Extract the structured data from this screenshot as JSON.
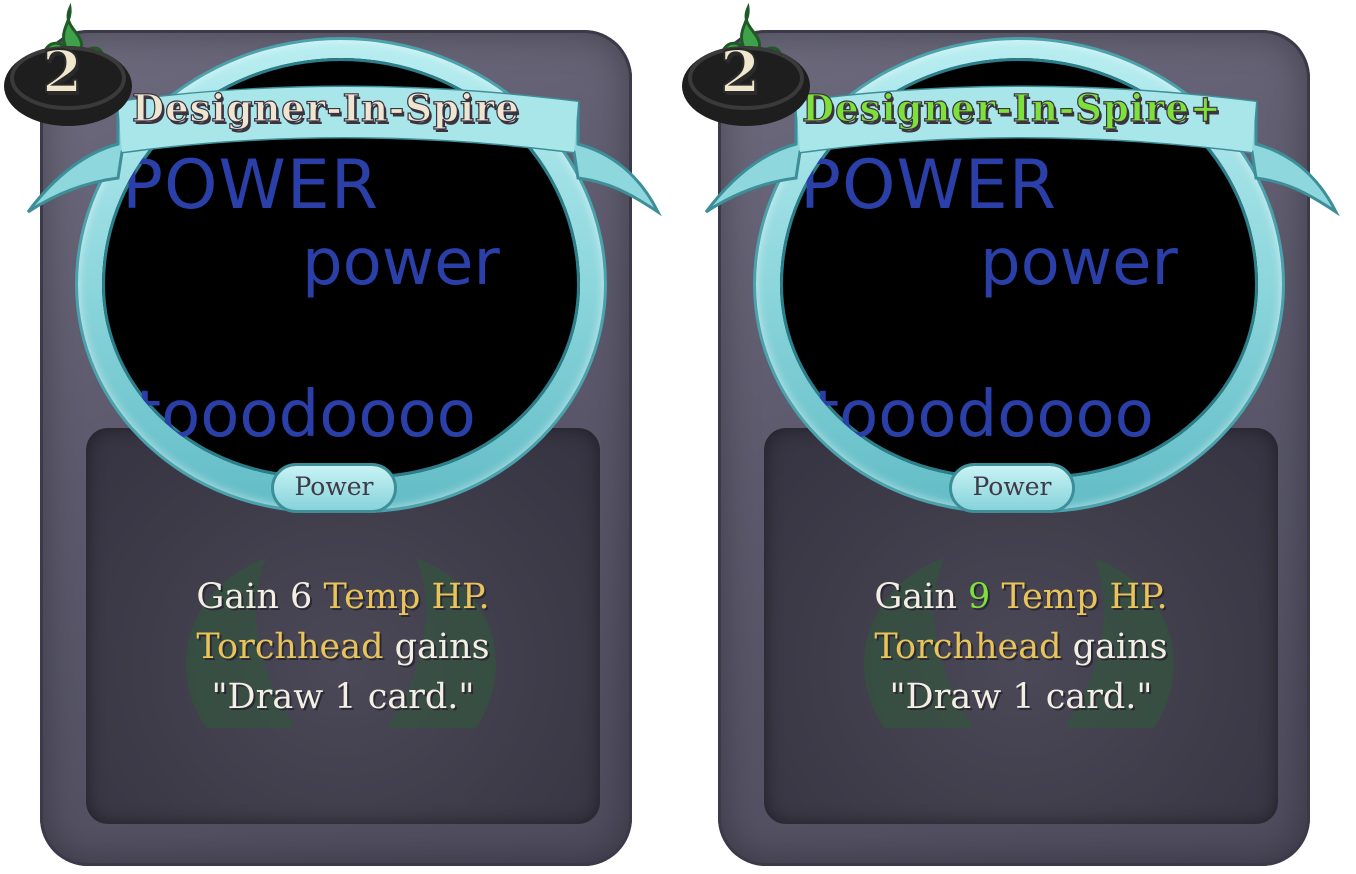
{
  "cards": [
    {
      "cost": "2",
      "title": "Designer-In-Spire",
      "title_color": "#efe6d2",
      "art_lines": [
        "POWER",
        "power",
        "tooodoooo"
      ],
      "type_label": "Power",
      "description": {
        "line1_pre": "Gain ",
        "line1_value": "6",
        "line1_keyword": "Temp HP",
        "line1_post": ".",
        "line2_keyword": "Torchhead",
        "line2_post": " gains",
        "line3": "\"Draw 1 card.\""
      }
    },
    {
      "cost": "2",
      "title": "Designer-In-Spire+",
      "title_color": "#7ee03a",
      "art_lines": [
        "POWER",
        "power",
        "tooodoooo"
      ],
      "type_label": "Power",
      "description": {
        "line1_pre": "Gain ",
        "line1_value": "9",
        "line1_keyword": "Temp HP",
        "line1_post": ".",
        "line2_keyword": "Torchhead",
        "line2_post": " gains",
        "line3": "\"Draw 1 card.\""
      }
    }
  ],
  "colors": {
    "keyword_gold": "#e9c45a",
    "upgrade_green": "#7ee03a",
    "art_text_blue": "#2a3fa8",
    "frame_teal": "#8ed7dd"
  }
}
